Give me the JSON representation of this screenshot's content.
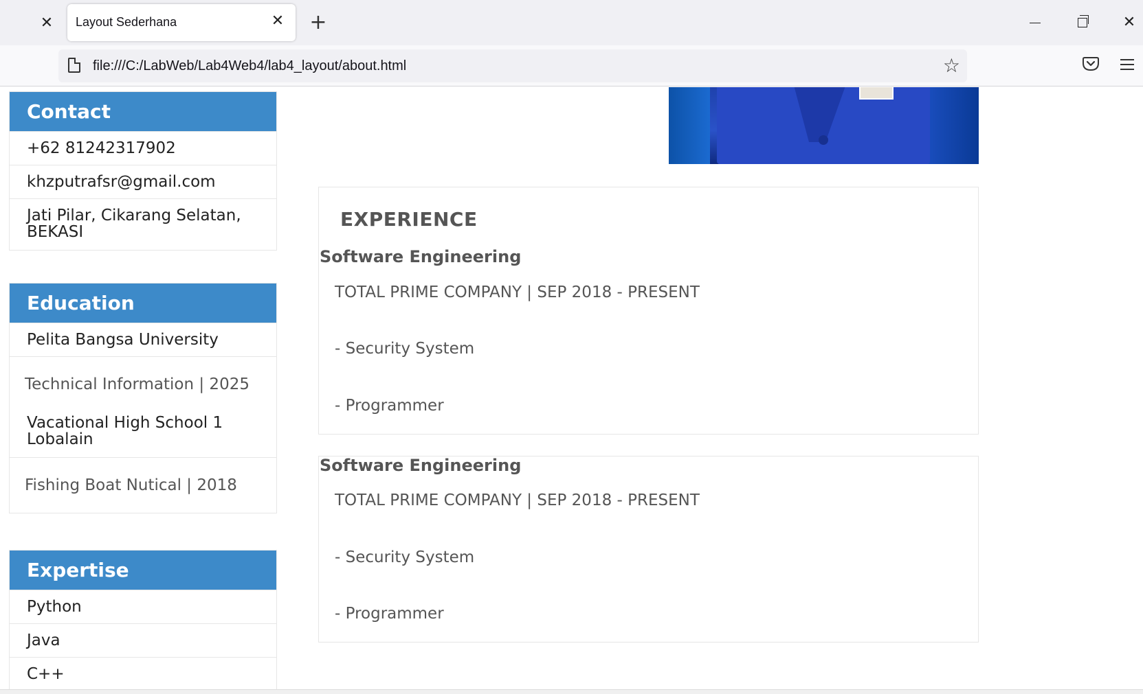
{
  "browser": {
    "tab_title": "Layout Sederhana",
    "url": "file:///C:/LabWeb/Lab4Web4/lab4_layout/about.html"
  },
  "sidebar": {
    "contact": {
      "header": "Contact",
      "items": [
        "+62 81242317902",
        "khzputrafsr@gmail.com",
        "Jati Pilar, Cikarang Selatan, BEKASI"
      ]
    },
    "education": {
      "header": "Education",
      "items": [
        {
          "text": "Pelita Bangsa University",
          "sub": false
        },
        {
          "text": "Technical Information | 2025",
          "sub": true
        },
        {
          "text": "Vacational High School 1 Lobalain",
          "sub": false
        },
        {
          "text": "Fishing Boat Nutical | 2018",
          "sub": true
        }
      ]
    },
    "expertise": {
      "header": "Expertise",
      "items": [
        "Python",
        "Java",
        "C++"
      ]
    }
  },
  "main": {
    "experience_title": "EXPERIENCE",
    "jobs": [
      {
        "title": "Software Engineering",
        "company": "TOTAL PRIME COMPANY | SEP 2018 - PRESENT",
        "roles": [
          "- Security System",
          "- Programmer"
        ]
      },
      {
        "title": "Software Engineering",
        "company": "TOTAL PRIME COMPANY | SEP 2018 - PRESENT",
        "roles": [
          "- Security System",
          "- Programmer"
        ]
      }
    ]
  },
  "colors": {
    "panel_header": "#3d8ac9",
    "heading_text": "#555555"
  }
}
